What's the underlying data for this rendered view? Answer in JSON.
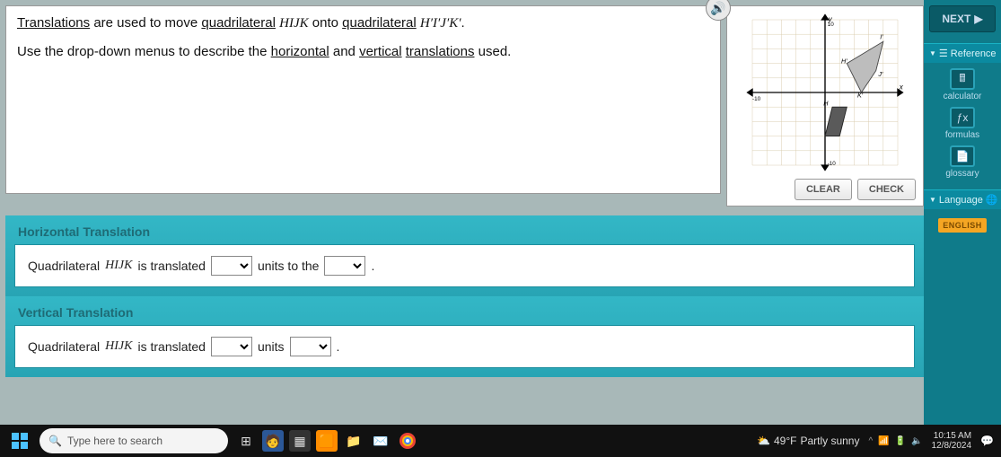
{
  "question": {
    "line1_pre": "Translations",
    "line1_mid1": " are used to move ",
    "line1_u1": "quadrilateral",
    "line1_sp1": " ",
    "line1_quad1": "HIJK",
    "line1_sp2": " onto ",
    "line1_u2": "quadrilateral",
    "line1_sp3": " ",
    "line1_quad2": "H′I′J′K′",
    "line1_end": ".",
    "line2_pre": "Use the drop-down menus to describe the ",
    "line2_u1": "horizontal",
    "line2_mid": " and ",
    "line2_u2": "vertical",
    "line2_sp": " ",
    "line2_u3": "translations",
    "line2_end": " used."
  },
  "graph": {
    "xlabel": "x",
    "ylabel": "y",
    "range": 10,
    "clear_label": "CLEAR",
    "check_label": "CHECK"
  },
  "panels": {
    "horizontal": {
      "heading": "Horizontal Translation",
      "text_pre": "Quadrilateral ",
      "quad": "HIJK",
      "text_mid1": " is translated ",
      "text_mid2": " units to the ",
      "text_end": "."
    },
    "vertical": {
      "heading": "Vertical Translation",
      "text_pre": "Quadrilateral ",
      "quad": "HIJK",
      "text_mid1": " is translated ",
      "text_mid2": " units ",
      "text_end": "."
    }
  },
  "sidebar": {
    "next": "NEXT",
    "reference": "Reference",
    "tools": {
      "calculator": "calculator",
      "formulas": "formulas",
      "glossary": "glossary"
    },
    "language_header": "Language",
    "language_value": "ENGLISH"
  },
  "taskbar": {
    "search_placeholder": "Type here to search",
    "weather_temp": "49°F",
    "weather_cond": "Partly sunny",
    "time": "10:15 AM",
    "date": "12/8/2024"
  },
  "chart_data": {
    "type": "scatter",
    "title": "",
    "xlabel": "x",
    "ylabel": "y",
    "xlim": [
      -10,
      10
    ],
    "ylim": [
      -10,
      10
    ],
    "series": [
      {
        "name": "HIJK",
        "points": [
          {
            "label": "H",
            "x": 1,
            "y": -2
          },
          {
            "label": "I",
            "x": 3,
            "y": -2
          },
          {
            "label": "J",
            "x": 2,
            "y": -6
          },
          {
            "label": "K",
            "x": 0,
            "y": -6
          }
        ]
      },
      {
        "name": "H'I'J'K'",
        "points": [
          {
            "label": "H'",
            "x": 3,
            "y": 4
          },
          {
            "label": "I'",
            "x": 8,
            "y": 7
          },
          {
            "label": "J'",
            "x": 7,
            "y": 3
          },
          {
            "label": "K'",
            "x": 5,
            "y": 0
          }
        ]
      }
    ]
  }
}
